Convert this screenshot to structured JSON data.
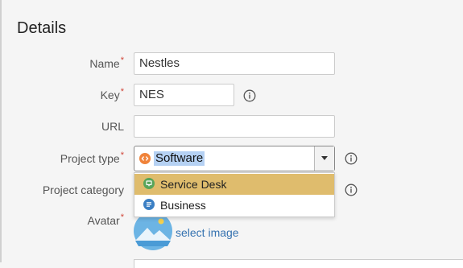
{
  "section_title": "Details",
  "fields": {
    "name": {
      "label": "Name",
      "required": "*",
      "value": "Nestles"
    },
    "key": {
      "label": "Key",
      "required": "*",
      "value": "NES"
    },
    "url": {
      "label": "URL",
      "value": ""
    },
    "project_type": {
      "label": "Project type",
      "required": "*",
      "selected": "Software",
      "selected_icon": "software-type-icon"
    },
    "project_category": {
      "label": "Project category"
    },
    "avatar": {
      "label": "Avatar",
      "required": "*",
      "link_text": "select image"
    }
  },
  "dropdown": {
    "options": [
      {
        "label": "Service Desk",
        "icon": "service-desk-icon",
        "highlighted": true
      },
      {
        "label": "Business",
        "icon": "business-icon",
        "highlighted": false
      }
    ]
  },
  "colors": {
    "required_marker": "#d04437",
    "highlight": "#dfbc6d",
    "selection": "#b5d1f3",
    "link": "#3572b0",
    "software_icon": "#f0833a",
    "service_desk_icon": "#57a55a",
    "business_icon": "#3b7fc4"
  }
}
